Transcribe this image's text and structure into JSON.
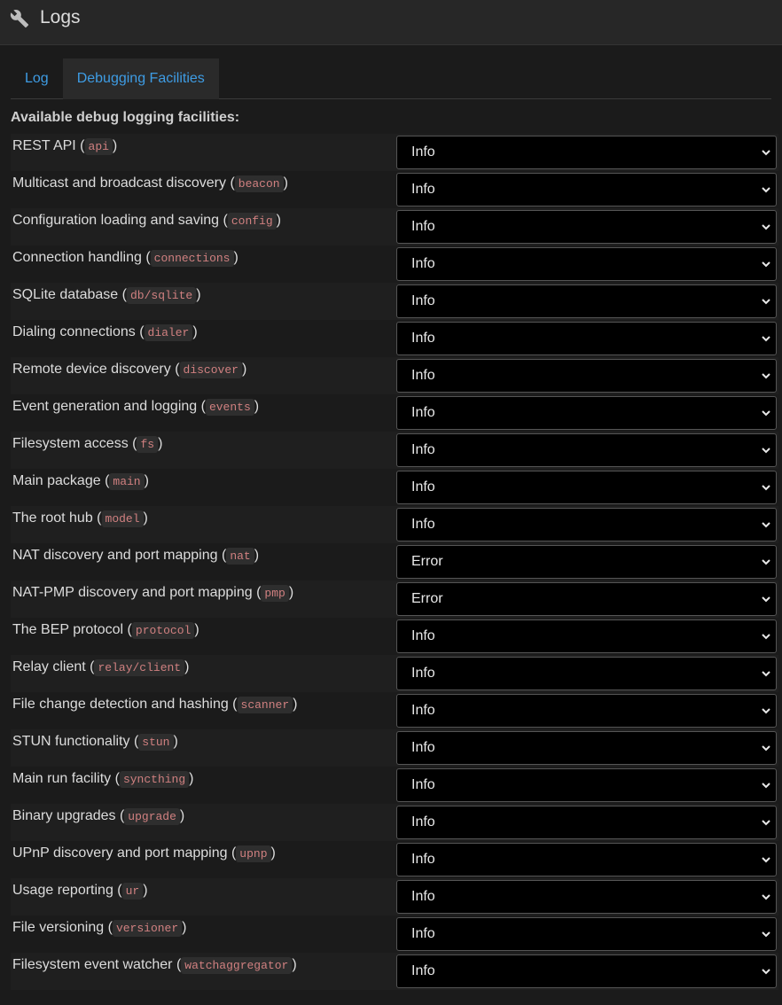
{
  "header": {
    "title": "Logs",
    "icon": "wrench-icon"
  },
  "tabs": [
    {
      "label": "Log",
      "active": false
    },
    {
      "label": "Debugging Facilities",
      "active": true
    }
  ],
  "section_label": "Available debug logging facilities:",
  "facilities": [
    {
      "desc": "REST API",
      "code": "api",
      "level": "Info"
    },
    {
      "desc": "Multicast and broadcast discovery",
      "code": "beacon",
      "level": "Info"
    },
    {
      "desc": "Configuration loading and saving",
      "code": "config",
      "level": "Info"
    },
    {
      "desc": "Connection handling",
      "code": "connections",
      "level": "Info"
    },
    {
      "desc": "SQLite database",
      "code": "db/sqlite",
      "level": "Info"
    },
    {
      "desc": "Dialing connections",
      "code": "dialer",
      "level": "Info"
    },
    {
      "desc": "Remote device discovery",
      "code": "discover",
      "level": "Info"
    },
    {
      "desc": "Event generation and logging",
      "code": "events",
      "level": "Info"
    },
    {
      "desc": "Filesystem access",
      "code": "fs",
      "level": "Info"
    },
    {
      "desc": "Main package",
      "code": "main",
      "level": "Info"
    },
    {
      "desc": "The root hub",
      "code": "model",
      "level": "Info"
    },
    {
      "desc": "NAT discovery and port mapping",
      "code": "nat",
      "level": "Error"
    },
    {
      "desc": "NAT-PMP discovery and port mapping",
      "code": "pmp",
      "level": "Error"
    },
    {
      "desc": "The BEP protocol",
      "code": "protocol",
      "level": "Info"
    },
    {
      "desc": "Relay client",
      "code": "relay/client",
      "level": "Info"
    },
    {
      "desc": "File change detection and hashing",
      "code": "scanner",
      "level": "Info"
    },
    {
      "desc": "STUN functionality",
      "code": "stun",
      "level": "Info"
    },
    {
      "desc": "Main run facility",
      "code": "syncthing",
      "level": "Info"
    },
    {
      "desc": "Binary upgrades",
      "code": "upgrade",
      "level": "Info"
    },
    {
      "desc": "UPnP discovery and port mapping",
      "code": "upnp",
      "level": "Info"
    },
    {
      "desc": "Usage reporting",
      "code": "ur",
      "level": "Info"
    },
    {
      "desc": "File versioning",
      "code": "versioner",
      "level": "Info"
    },
    {
      "desc": "Filesystem event watcher",
      "code": "watchaggregator",
      "level": "Info"
    }
  ],
  "colors": {
    "accent": "#3e9ce4",
    "code_text": "#d08080",
    "background": "#1b1b1b"
  }
}
